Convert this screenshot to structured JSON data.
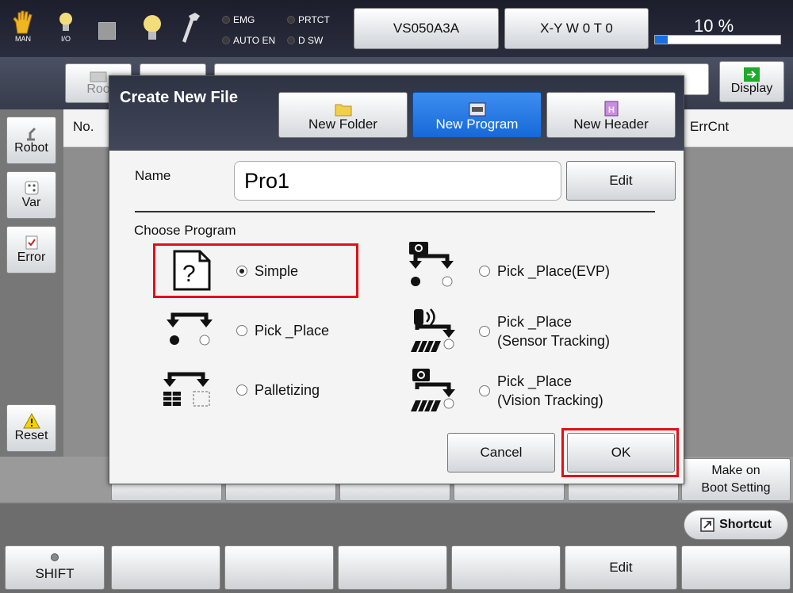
{
  "topbar": {
    "mode_label": "MAN",
    "io_label": "I/O",
    "indicators": [
      "EMG",
      "PRTCT",
      "AUTO EN",
      "D SW"
    ],
    "robot_name": "VS050A3A",
    "coord_label": "X-Y  W 0 T 0",
    "speed_percent": "10 %",
    "speed_value": 10
  },
  "toolbar": {
    "root_label": "Roo",
    "display_label": "Display"
  },
  "sidebar": {
    "robot_label": "Robot",
    "var_label": "Var",
    "error_label": "Error",
    "reset_label": "Reset"
  },
  "list": {
    "col_no": "No.",
    "col_errcnt": "ErrCnt"
  },
  "bottom": {
    "make_on_boot_line1": "Make on",
    "make_on_boot_line2": "Boot Setting",
    "shortcut_label": "Shortcut",
    "shift_label": "SHIFT",
    "edit_label": "Edit"
  },
  "dialog": {
    "title": "Create New File",
    "tabs": [
      {
        "label": "New Folder",
        "active": false
      },
      {
        "label": "New Program",
        "active": true
      },
      {
        "label": "New Header",
        "active": false
      }
    ],
    "name_label": "Name",
    "name_value": "Pro1",
    "edit_button": "Edit",
    "choose_label": "Choose Program",
    "options": [
      {
        "line1": "Simple",
        "line2": "",
        "selected": true
      },
      {
        "line1": "Pick _Place",
        "line2": "",
        "selected": false
      },
      {
        "line1": "Palletizing",
        "line2": "",
        "selected": false
      },
      {
        "line1": "Pick _Place(EVP)",
        "line2": "",
        "selected": false
      },
      {
        "line1": "Pick _Place",
        "line2": "(Sensor Tracking)",
        "selected": false
      },
      {
        "line1": "Pick _Place",
        "line2": "(Vision Tracking)",
        "selected": false
      }
    ],
    "cancel_button": "Cancel",
    "ok_button": "OK"
  },
  "colors": {
    "highlight": "#e0101a",
    "active_tab": "#1769d8"
  }
}
